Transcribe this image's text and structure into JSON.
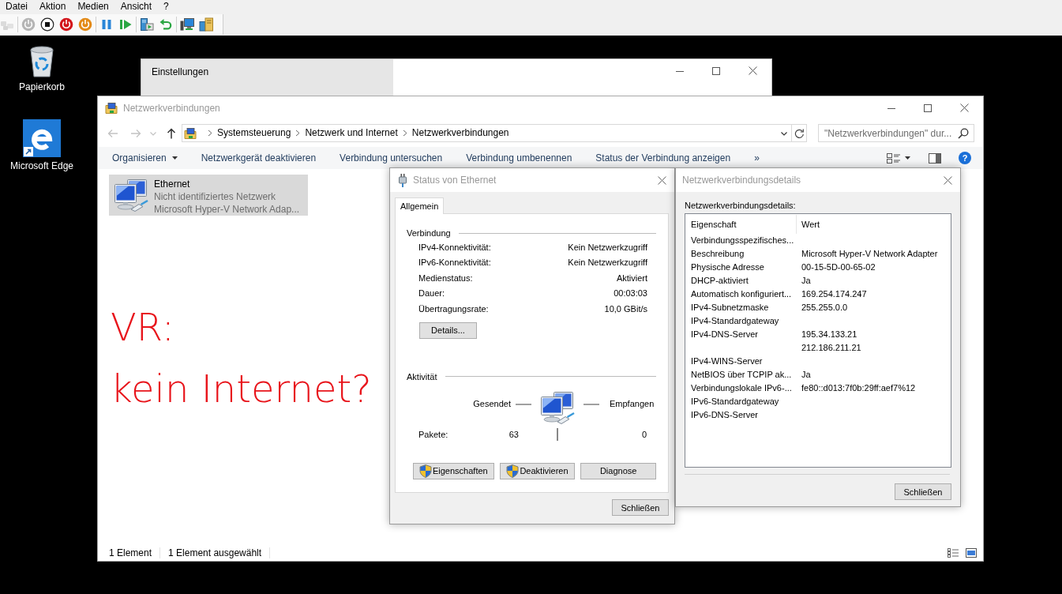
{
  "vm_window": {
    "menu": [
      "Datei",
      "Aktion",
      "Medien",
      "Ansicht",
      "?"
    ],
    "toolbar_groups": [
      [
        {
          "kind": "ctrl-alt-del",
          "disabled": true
        }
      ],
      [
        {
          "kind": "start",
          "disabled": true
        },
        {
          "kind": "turn-off",
          "disabled": false
        },
        {
          "kind": "shut-down",
          "disabled": false
        },
        {
          "kind": "save",
          "disabled": false
        }
      ],
      [
        {
          "kind": "pause",
          "disabled": false
        },
        {
          "kind": "reset",
          "disabled": false
        }
      ],
      [
        {
          "kind": "checkpoint",
          "disabled": false
        },
        {
          "kind": "revert",
          "disabled": false
        }
      ],
      [
        {
          "kind": "enhanced-session",
          "disabled": false
        },
        {
          "kind": "share",
          "disabled": false
        }
      ]
    ]
  },
  "desktop_icons": [
    {
      "kind": "recycle-bin",
      "label": "Papierkorb"
    },
    {
      "kind": "edge",
      "label": "Microsoft Edge"
    }
  ],
  "settings_window": {
    "title": "Einstellungen"
  },
  "explorer": {
    "title": "Netzwerkverbindungen",
    "active": false,
    "navigation": [
      {
        "kind": "back",
        "disabled": true
      },
      {
        "kind": "forward",
        "disabled": true
      },
      {
        "kind": "recent",
        "disabled": true
      },
      {
        "kind": "up",
        "disabled": false
      }
    ],
    "breadcrumb": [
      "Systemsteuerung",
      "Netzwerk und Internet",
      "Netzwerkverbindungen"
    ],
    "search": {
      "placeholder": "\"Netzwerkverbindungen\" dur..."
    },
    "commands": [
      {
        "kind": "menu",
        "label": "Organisieren"
      },
      {
        "kind": "command",
        "label": "Netzwerkgerät deaktivieren"
      },
      {
        "kind": "command",
        "label": "Verbindung untersuchen"
      },
      {
        "kind": "command",
        "label": "Verbindung umbenennen"
      },
      {
        "kind": "command",
        "label": "Status der Verbindung anzeigen"
      },
      {
        "kind": "overflow",
        "label": "»"
      }
    ],
    "help_button": "?",
    "items": [
      {
        "name": "Ethernet",
        "status": "Nicht identifiziertes Netzwerk",
        "adapter": "Microsoft Hyper-V Network Adap...",
        "selected": true
      }
    ],
    "status_bar": [
      "1 Element",
      "1 Element ausgewählt"
    ]
  },
  "handwritten_note": [
    "VR:",
    "kein Internet?"
  ],
  "status_dialog": {
    "title": "Status von Ethernet",
    "active": false,
    "tabs": [
      {
        "label": "Allgemein",
        "selected": true
      }
    ],
    "connection": {
      "heading": "Verbindung",
      "rows": [
        {
          "label": "IPv4-Konnektivität:",
          "value": "Kein Netzwerkzugriff"
        },
        {
          "label": "IPv6-Konnektivität:",
          "value": "Kein Netzwerkzugriff"
        },
        {
          "label": "Medienstatus:",
          "value": "Aktiviert"
        },
        {
          "label": "Dauer:",
          "value": "00:03:03"
        },
        {
          "label": "Übertragungsrate:",
          "value": "10,0 GBit/s"
        }
      ],
      "details_button": "Details..."
    },
    "activity": {
      "heading": "Aktivität",
      "sent_label": "Gesendet",
      "received_label": "Empfangen",
      "packets_label": "Pakete:",
      "packets_sent": "63",
      "packets_received": "0"
    },
    "buttons": [
      {
        "label": "Eigenschaften",
        "shield": true
      },
      {
        "label": "Deaktivieren",
        "shield": true
      },
      {
        "label": "Diagnose",
        "shield": false
      }
    ],
    "close_button": "Schließen"
  },
  "details_dialog": {
    "title": "Netzwerkverbindungsdetails",
    "active": false,
    "caption": "Netzwerkverbindungsdetails:",
    "columns": [
      "Eigenschaft",
      "Wert"
    ],
    "rows": [
      {
        "property": "Verbindungsspezifisches..."
      },
      {
        "property": "Beschreibung",
        "value": "Microsoft Hyper-V Network Adapter"
      },
      {
        "property": "Physische Adresse",
        "value": "00-15-5D-00-65-02"
      },
      {
        "property": "DHCP-aktiviert",
        "value": "Ja"
      },
      {
        "property": "Automatisch konfiguriert...",
        "value": "169.254.174.247"
      },
      {
        "property": "IPv4-Subnetzmaske",
        "value": "255.255.0.0"
      },
      {
        "property": "IPv4-Standardgateway"
      },
      {
        "property": "IPv4-DNS-Server",
        "value": "195.34.133.21"
      },
      {
        "value": "212.186.211.21"
      },
      {
        "property": "IPv4-WINS-Server"
      },
      {
        "property": "NetBIOS über TCPIP ak...",
        "value": "Ja"
      },
      {
        "property": "Verbindungslokale IPv6-...",
        "value": "fe80::d013:7f0b:29ff:aef7%12"
      },
      {
        "property": "IPv6-Standardgateway"
      },
      {
        "property": "IPv6-DNS-Server"
      }
    ],
    "close_button": "Schließen"
  }
}
